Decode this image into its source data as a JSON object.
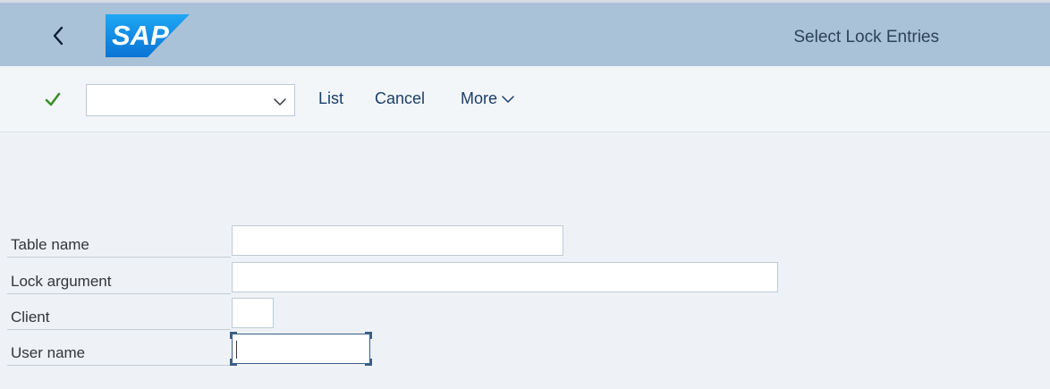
{
  "shell": {
    "back_icon": "chevron-left-icon",
    "logo_text": "SAP",
    "title": "Select Lock Entries"
  },
  "toolbar": {
    "ok_icon": "checkmark-icon",
    "command_field": {
      "value": "",
      "placeholder": ""
    },
    "list_label": "List",
    "cancel_label": "Cancel",
    "more_label": "More"
  },
  "form": {
    "fields": [
      {
        "label": "Table name",
        "value": ""
      },
      {
        "label": "Lock argument",
        "value": ""
      },
      {
        "label": "Client",
        "value": ""
      },
      {
        "label": "User name",
        "value": ""
      }
    ]
  },
  "colors": {
    "shell_bg": "#a9c2d8",
    "page_bg": "#eef2f6",
    "logo_blue": "#0a8de8",
    "ok_green": "#3a8f2b",
    "link_blue": "#1a3e6b"
  }
}
